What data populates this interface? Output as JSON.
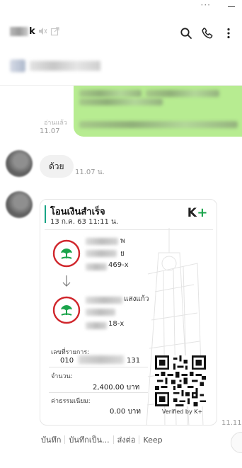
{
  "window": {
    "controls": [
      "menu-dots-icon",
      "minimize-icon"
    ]
  },
  "header": {
    "title_suffix": "k",
    "actions": [
      "search-icon",
      "phone-icon",
      "more-icon"
    ]
  },
  "messages": {
    "read_label": "อ่านแล้ว",
    "sent_time": "11.07",
    "reply_text": "ด้วย",
    "reply_time": "11.07 น.",
    "receipt_time": "11.11"
  },
  "receipt": {
    "title": "โอนเงินสำเร็จ",
    "date": "13 ก.ค. 63  11:11 น.",
    "logo_text": "K",
    "logo_plus": "+",
    "sender": {
      "name_partial": "พ",
      "name_partial2": "ย",
      "account_suffix": "469-x"
    },
    "receiver": {
      "name_partial": "แสงแก้ว",
      "account_suffix": "18-x"
    },
    "ref_label": "เลขที่รายการ:",
    "ref_prefix": "010",
    "ref_suffix": "131",
    "amount_label": "จำนวน:",
    "amount_value": "2,400.00 บาท",
    "fee_label": "ค่าธรรมเนียม:",
    "fee_value": "0.00 บาท",
    "verified_text": "Verified by K+"
  },
  "message_actions": {
    "save": "บันทึก",
    "save_album": "บันทึกเป็น...",
    "forward": "ส่งต่อ",
    "keep": "Keep"
  },
  "colors": {
    "sent_bubble": "#b7ec91",
    "kbank_green": "#1aa44b",
    "kbank_red": "#d0262c",
    "accent_teal": "#18a486"
  }
}
